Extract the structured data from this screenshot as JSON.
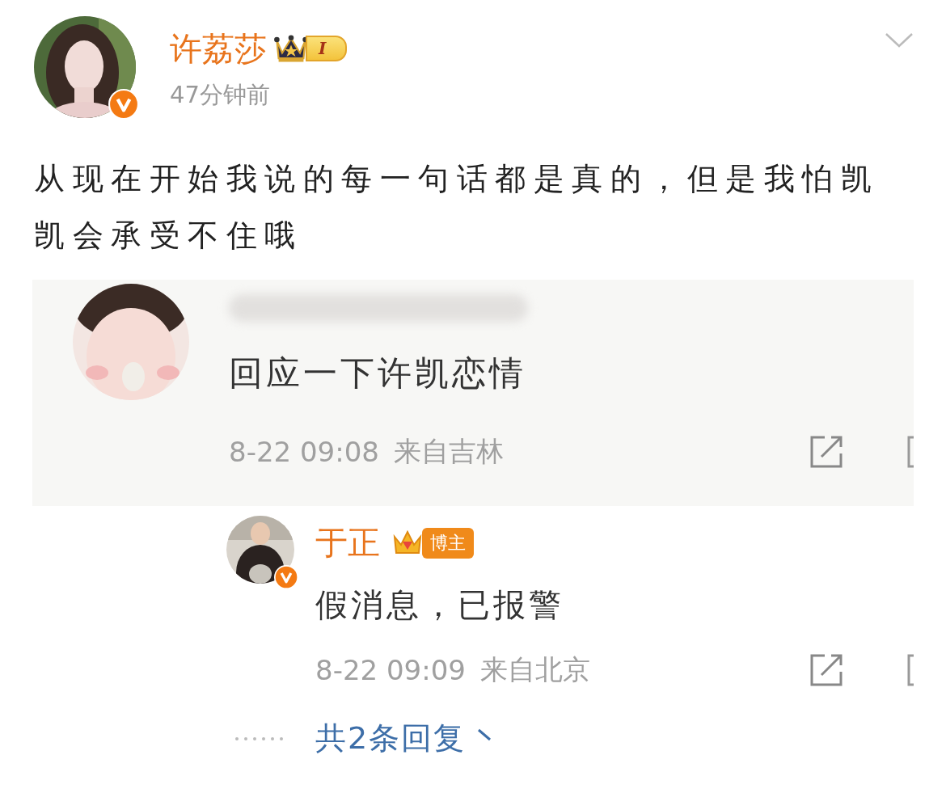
{
  "post": {
    "author": {
      "name": "许荔莎",
      "verified": true,
      "level_badge": "I"
    },
    "time": "47分钟前",
    "text": "从现在开始我说的每一句话都是真的，但是我怕凯凯会承受不住哦",
    "embedded_screenshot": {
      "comment": {
        "text": "回应一下许凯恋情",
        "date": "8-22 09:08",
        "location": "来自吉林"
      },
      "reply": {
        "author": "于正",
        "verified": true,
        "badge": "博主",
        "text": "假消息，已报警",
        "date": "8-22 09:09",
        "location": "来自北京"
      },
      "reply_count": "共2条回复"
    }
  }
}
